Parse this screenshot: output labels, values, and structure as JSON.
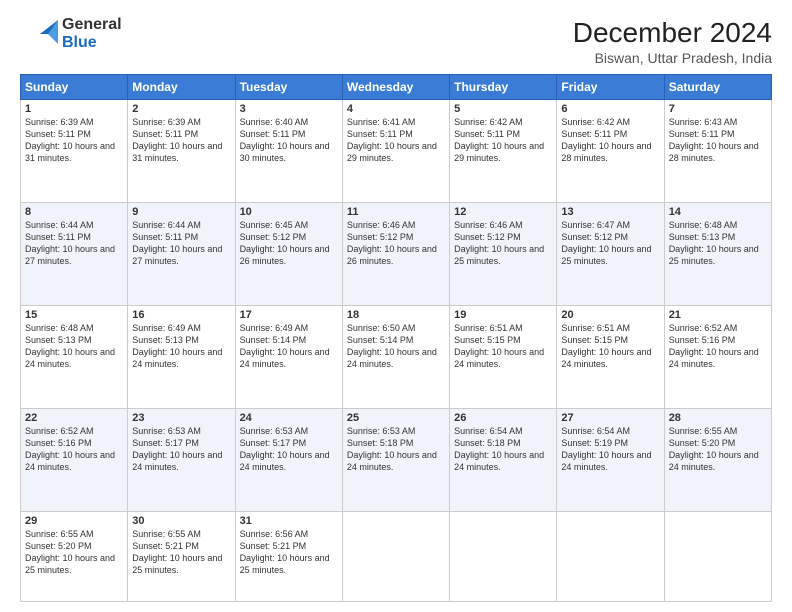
{
  "logo": {
    "line1": "General",
    "line2": "Blue"
  },
  "title": "December 2024",
  "subtitle": "Biswan, Uttar Pradesh, India",
  "header_days": [
    "Sunday",
    "Monday",
    "Tuesday",
    "Wednesday",
    "Thursday",
    "Friday",
    "Saturday"
  ],
  "weeks": [
    [
      {
        "day": "1",
        "sunrise": "6:39 AM",
        "sunset": "5:11 PM",
        "daylight": "10 hours and 31 minutes."
      },
      {
        "day": "2",
        "sunrise": "6:39 AM",
        "sunset": "5:11 PM",
        "daylight": "10 hours and 31 minutes."
      },
      {
        "day": "3",
        "sunrise": "6:40 AM",
        "sunset": "5:11 PM",
        "daylight": "10 hours and 30 minutes."
      },
      {
        "day": "4",
        "sunrise": "6:41 AM",
        "sunset": "5:11 PM",
        "daylight": "10 hours and 29 minutes."
      },
      {
        "day": "5",
        "sunrise": "6:42 AM",
        "sunset": "5:11 PM",
        "daylight": "10 hours and 29 minutes."
      },
      {
        "day": "6",
        "sunrise": "6:42 AM",
        "sunset": "5:11 PM",
        "daylight": "10 hours and 28 minutes."
      },
      {
        "day": "7",
        "sunrise": "6:43 AM",
        "sunset": "5:11 PM",
        "daylight": "10 hours and 28 minutes."
      }
    ],
    [
      {
        "day": "8",
        "sunrise": "6:44 AM",
        "sunset": "5:11 PM",
        "daylight": "10 hours and 27 minutes."
      },
      {
        "day": "9",
        "sunrise": "6:44 AM",
        "sunset": "5:11 PM",
        "daylight": "10 hours and 27 minutes."
      },
      {
        "day": "10",
        "sunrise": "6:45 AM",
        "sunset": "5:12 PM",
        "daylight": "10 hours and 26 minutes."
      },
      {
        "day": "11",
        "sunrise": "6:46 AM",
        "sunset": "5:12 PM",
        "daylight": "10 hours and 26 minutes."
      },
      {
        "day": "12",
        "sunrise": "6:46 AM",
        "sunset": "5:12 PM",
        "daylight": "10 hours and 25 minutes."
      },
      {
        "day": "13",
        "sunrise": "6:47 AM",
        "sunset": "5:12 PM",
        "daylight": "10 hours and 25 minutes."
      },
      {
        "day": "14",
        "sunrise": "6:48 AM",
        "sunset": "5:13 PM",
        "daylight": "10 hours and 25 minutes."
      }
    ],
    [
      {
        "day": "15",
        "sunrise": "6:48 AM",
        "sunset": "5:13 PM",
        "daylight": "10 hours and 24 minutes."
      },
      {
        "day": "16",
        "sunrise": "6:49 AM",
        "sunset": "5:13 PM",
        "daylight": "10 hours and 24 minutes."
      },
      {
        "day": "17",
        "sunrise": "6:49 AM",
        "sunset": "5:14 PM",
        "daylight": "10 hours and 24 minutes."
      },
      {
        "day": "18",
        "sunrise": "6:50 AM",
        "sunset": "5:14 PM",
        "daylight": "10 hours and 24 minutes."
      },
      {
        "day": "19",
        "sunrise": "6:51 AM",
        "sunset": "5:15 PM",
        "daylight": "10 hours and 24 minutes."
      },
      {
        "day": "20",
        "sunrise": "6:51 AM",
        "sunset": "5:15 PM",
        "daylight": "10 hours and 24 minutes."
      },
      {
        "day": "21",
        "sunrise": "6:52 AM",
        "sunset": "5:16 PM",
        "daylight": "10 hours and 24 minutes."
      }
    ],
    [
      {
        "day": "22",
        "sunrise": "6:52 AM",
        "sunset": "5:16 PM",
        "daylight": "10 hours and 24 minutes."
      },
      {
        "day": "23",
        "sunrise": "6:53 AM",
        "sunset": "5:17 PM",
        "daylight": "10 hours and 24 minutes."
      },
      {
        "day": "24",
        "sunrise": "6:53 AM",
        "sunset": "5:17 PM",
        "daylight": "10 hours and 24 minutes."
      },
      {
        "day": "25",
        "sunrise": "6:53 AM",
        "sunset": "5:18 PM",
        "daylight": "10 hours and 24 minutes."
      },
      {
        "day": "26",
        "sunrise": "6:54 AM",
        "sunset": "5:18 PM",
        "daylight": "10 hours and 24 minutes."
      },
      {
        "day": "27",
        "sunrise": "6:54 AM",
        "sunset": "5:19 PM",
        "daylight": "10 hours and 24 minutes."
      },
      {
        "day": "28",
        "sunrise": "6:55 AM",
        "sunset": "5:20 PM",
        "daylight": "10 hours and 24 minutes."
      }
    ],
    [
      {
        "day": "29",
        "sunrise": "6:55 AM",
        "sunset": "5:20 PM",
        "daylight": "10 hours and 25 minutes."
      },
      {
        "day": "30",
        "sunrise": "6:55 AM",
        "sunset": "5:21 PM",
        "daylight": "10 hours and 25 minutes."
      },
      {
        "day": "31",
        "sunrise": "6:56 AM",
        "sunset": "5:21 PM",
        "daylight": "10 hours and 25 minutes."
      },
      null,
      null,
      null,
      null
    ]
  ]
}
